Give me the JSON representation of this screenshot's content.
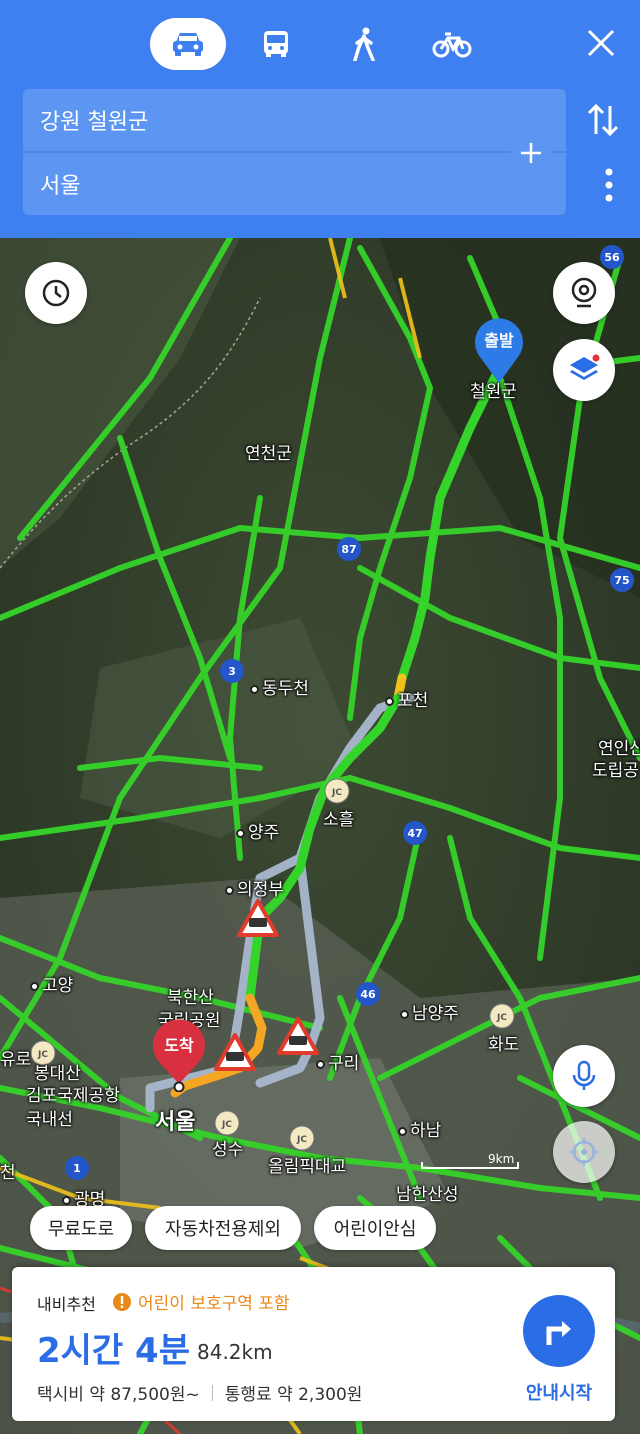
{
  "header": {
    "modes": [
      {
        "name": "car",
        "icon": "car-icon",
        "active": true
      },
      {
        "name": "bus",
        "icon": "bus-icon",
        "active": false
      },
      {
        "name": "walk",
        "icon": "walk-icon",
        "active": false
      },
      {
        "name": "bike",
        "icon": "bike-icon",
        "active": false
      }
    ],
    "origin": "강원 철원군",
    "destination": "서울"
  },
  "map": {
    "start_label": "출발",
    "end_label": "도착",
    "places": {
      "cheorwon": "철원군",
      "yeoncheon": "연천군",
      "dongducheon": "동두천",
      "pocheon": "포천",
      "soheul": "소흘",
      "yangju": "양주",
      "uijeongbu": "의정부",
      "goyang": "고양",
      "bukhansan": "북한산",
      "bukhansan2": "국립공원",
      "namyangju": "남양주",
      "hwado": "화도",
      "guri": "구리",
      "bongdaesan": "봉대산",
      "gimpo_airport": "김포국제공항",
      "domestic": "국내선",
      "seoul": "서울",
      "seongsu": "성수",
      "olympic_bridge": "올림픽대교",
      "hanam": "하남",
      "namhansanseong": "남한산성",
      "gwangmyeong": "광명",
      "yeonin": "연인산",
      "yeonin2": "도립공",
      "yuro": "유로",
      "cheon": "천"
    },
    "road_numbers": [
      "87",
      "3",
      "47",
      "46",
      "56",
      "75",
      "1",
      "JC"
    ],
    "scale_label": "9km"
  },
  "filters": [
    "무료도로",
    "자동차전용제외",
    "어린이안심"
  ],
  "route_card": {
    "label": "내비추천",
    "warning": "어린이 보호구역 포함",
    "duration": "2시간 4분",
    "distance": "84.2km",
    "taxi_fare": "택시비 약 87,500원~",
    "toll": "통행료 약 2,300원",
    "nav_start": "안내시작"
  },
  "colors": {
    "header_bg": "#3f80f0",
    "route_blue": "#2a6de6",
    "warning": "#e8891a",
    "traffic_green": "#35d42a",
    "traffic_yellow": "#f0c21a",
    "traffic_red": "#e83a2a"
  }
}
